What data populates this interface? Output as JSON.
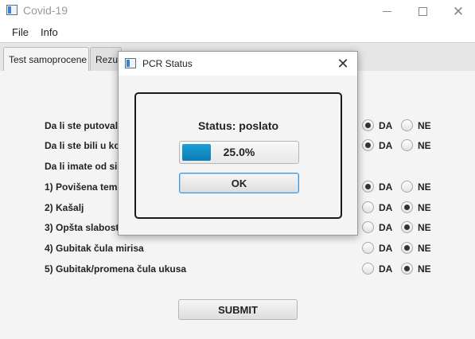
{
  "window": {
    "title": "Covid-19",
    "app_icon": "java-app-icon"
  },
  "menu": {
    "items": [
      "File",
      "Info"
    ]
  },
  "tabs": [
    {
      "label": "Test samoprocene",
      "active": true
    },
    {
      "label": "Rezul",
      "active": false
    }
  ],
  "questions": [
    {
      "label": "Da li ste putoval",
      "radios": true,
      "selected": "DA"
    },
    {
      "label": "Da li ste bili u ko",
      "radios": true,
      "selected": "DA"
    },
    {
      "label": "Da li imate od si",
      "radios": false,
      "selected": null
    },
    {
      "label": "1) Povišena temp",
      "radios": true,
      "selected": "DA"
    },
    {
      "label": "2) Kašalj",
      "radios": true,
      "selected": "NE"
    },
    {
      "label": "3) Opšta slabost",
      "radios": true,
      "selected": "NE"
    },
    {
      "label": "4) Gubitak čula mirisa",
      "radios": true,
      "selected": "NE"
    },
    {
      "label": "5) Gubitak/promena čula ukusa",
      "radios": true,
      "selected": "NE"
    }
  ],
  "radio_labels": {
    "yes": "DA",
    "no": "NE"
  },
  "submit_label": "SUBMIT",
  "dialog": {
    "title": "PCR Status",
    "status_text": "Status: poslato",
    "progress": 0.25,
    "progress_text": "25.0%",
    "ok_label": "OK",
    "accent_color": "#0b8ac4"
  }
}
